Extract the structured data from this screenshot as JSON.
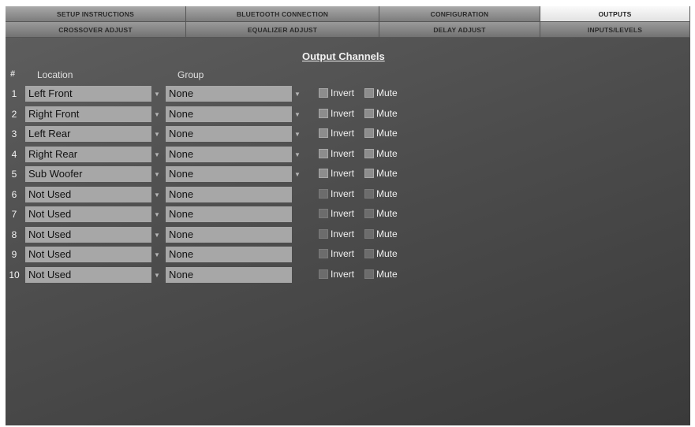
{
  "tabs_row1": [
    {
      "label": "SETUP INSTRUCTIONS",
      "active": false
    },
    {
      "label": "BLUETOOTH CONNECTION",
      "active": false
    },
    {
      "label": "CONFIGURATION",
      "active": false
    },
    {
      "label": "OUTPUTS",
      "active": true
    }
  ],
  "tabs_row2": [
    {
      "label": "CROSSOVER ADJUST",
      "active": false
    },
    {
      "label": "EQUALIZER ADJUST",
      "active": false
    },
    {
      "label": "DELAY ADJUST",
      "active": false
    },
    {
      "label": "INPUTS/LEVELS",
      "active": false
    }
  ],
  "page_title": "Output Channels",
  "headers": {
    "number": "#",
    "location": "Location",
    "group": "Group"
  },
  "labels": {
    "invert": "Invert",
    "mute": "Mute"
  },
  "channels": [
    {
      "num": "1",
      "location": "Left Front",
      "group": "None",
      "invert": false,
      "mute": false,
      "enabled": true
    },
    {
      "num": "2",
      "location": "Right Front",
      "group": "None",
      "invert": false,
      "mute": false,
      "enabled": true
    },
    {
      "num": "3",
      "location": "Left Rear",
      "group": "None",
      "invert": false,
      "mute": false,
      "enabled": true
    },
    {
      "num": "4",
      "location": "Right Rear",
      "group": "None",
      "invert": false,
      "mute": false,
      "enabled": true
    },
    {
      "num": "5",
      "location": "Sub Woofer",
      "group": "None",
      "invert": false,
      "mute": false,
      "enabled": true
    },
    {
      "num": "6",
      "location": "Not Used",
      "group": "None",
      "invert": false,
      "mute": false,
      "enabled": false
    },
    {
      "num": "7",
      "location": "Not Used",
      "group": "None",
      "invert": false,
      "mute": false,
      "enabled": false
    },
    {
      "num": "8",
      "location": "Not Used",
      "group": "None",
      "invert": false,
      "mute": false,
      "enabled": false
    },
    {
      "num": "9",
      "location": "Not Used",
      "group": "None",
      "invert": false,
      "mute": false,
      "enabled": false
    },
    {
      "num": "10",
      "location": "Not Used",
      "group": "None",
      "invert": false,
      "mute": false,
      "enabled": false
    }
  ],
  "icons": {
    "dropdown": "dropdown-arrow-icon"
  }
}
